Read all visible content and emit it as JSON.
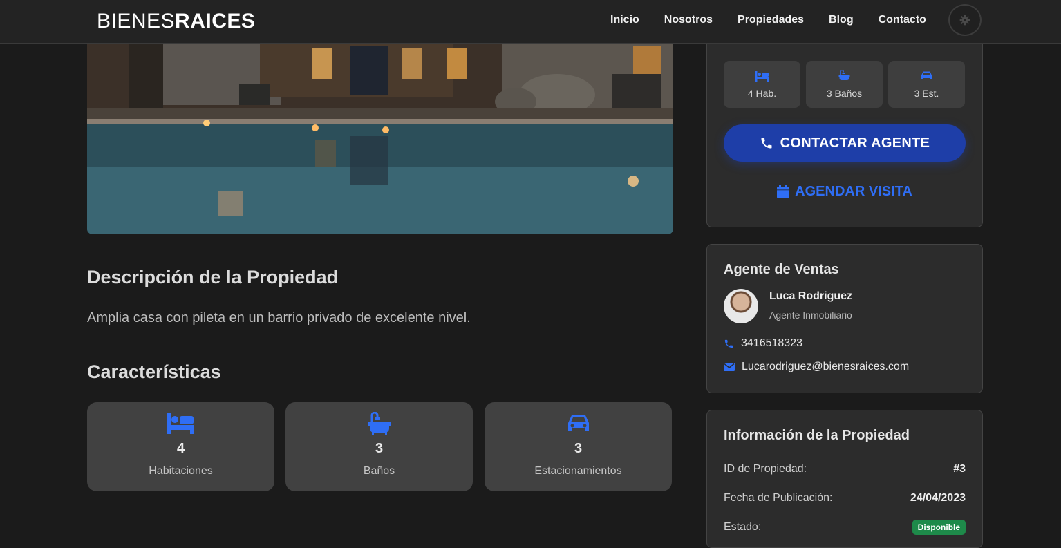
{
  "header": {
    "logo_light": "BIENES",
    "logo_bold": "RAICES",
    "nav": [
      {
        "label": "Inicio"
      },
      {
        "label": "Nosotros"
      },
      {
        "label": "Propiedades"
      },
      {
        "label": "Blog"
      },
      {
        "label": "Contacto"
      }
    ],
    "theme_icon": "gear-icon"
  },
  "main": {
    "description_title": "Descripción de la Propiedad",
    "description_text": "Amplia casa con pileta en un barrio privado de excelente nivel.",
    "features_title": "Características",
    "features": [
      {
        "icon": "bed-icon",
        "value": "4",
        "label": "Habitaciones"
      },
      {
        "icon": "bath-icon",
        "value": "3",
        "label": "Baños"
      },
      {
        "icon": "car-icon",
        "value": "3",
        "label": "Estacionamientos"
      }
    ]
  },
  "sidebar": {
    "quick_stats": [
      {
        "icon": "bed-icon",
        "label": "4 Hab."
      },
      {
        "icon": "bath-icon",
        "label": "3 Baños"
      },
      {
        "icon": "car-icon",
        "label": "3 Est."
      }
    ],
    "contact_button": "CONTACTAR AGENTE",
    "visit_button": "AGENDAR VISITA",
    "agent": {
      "title": "Agente de Ventas",
      "name": "Luca Rodriguez",
      "role": "Agente Inmobiliario",
      "phone": "3416518323",
      "email": "Lucarodriguez@bienesraices.com"
    },
    "info": {
      "title": "Información de la Propiedad",
      "rows": [
        {
          "key": "ID de Propiedad:",
          "value": "#3"
        },
        {
          "key": "Fecha de Publicación:",
          "value": "24/04/2023"
        },
        {
          "key": "Estado:",
          "value": "Disponible"
        }
      ]
    }
  },
  "colors": {
    "accent_blue": "#2f6ef5",
    "button_blue": "#1e3ea8",
    "badge_green": "#1e8a4a",
    "background": "#1b1b1b"
  }
}
